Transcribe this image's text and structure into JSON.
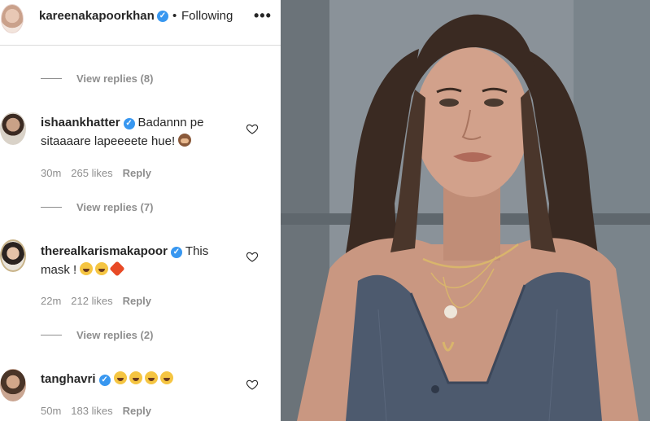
{
  "header": {
    "username": "kareenakapoorkhan",
    "separator": "•",
    "follow_status": "Following",
    "more_icon": "more-dots-icon"
  },
  "view_replies": [
    {
      "label": "View replies (8)"
    },
    {
      "label": "View replies (7)"
    },
    {
      "label": "View replies (2)"
    }
  ],
  "comments": [
    {
      "username": "ishaankhatter",
      "text": "Badannn pe sitaaaare lapeeeete hue!",
      "emoji": [
        "see-no-evil-monkey"
      ],
      "time": "30m",
      "likes": "265 likes",
      "reply": "Reply"
    },
    {
      "username": "therealkarismakapoor",
      "text": "This mask !",
      "emoji": [
        "tears-of-joy",
        "tears-of-joy",
        "collision"
      ],
      "time": "22m",
      "likes": "212 likes",
      "reply": "Reply"
    },
    {
      "username": "tanghavri",
      "text": "",
      "emoji": [
        "tears-of-joy",
        "tears-of-joy",
        "tears-of-joy",
        "tears-of-joy"
      ],
      "time": "50m",
      "likes": "183 likes",
      "reply": "Reply"
    }
  ],
  "colors": {
    "verified": "#3897f0",
    "secondary_text": "#8e8e8e",
    "primary_text": "#262626"
  }
}
